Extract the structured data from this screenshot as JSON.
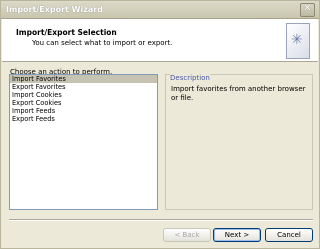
{
  "window": {
    "title": "Import/Export Wizard"
  },
  "header": {
    "title": "Import/Export Selection",
    "subtitle": "You can select what to import or export."
  },
  "actions": {
    "label": "Choose an action to perform.",
    "items": [
      {
        "label": "Import Favorites",
        "selected": true
      },
      {
        "label": "Export Favorites",
        "selected": false
      },
      {
        "label": "Import Cookies",
        "selected": false
      },
      {
        "label": "Export Cookies",
        "selected": false
      },
      {
        "label": "Import Feeds",
        "selected": false
      },
      {
        "label": "Export Feeds",
        "selected": false
      }
    ]
  },
  "description": {
    "label": "Description",
    "text": "Import favorites from another browser or file."
  },
  "buttons": {
    "back": "< Back",
    "next": "Next >",
    "cancel": "Cancel"
  }
}
